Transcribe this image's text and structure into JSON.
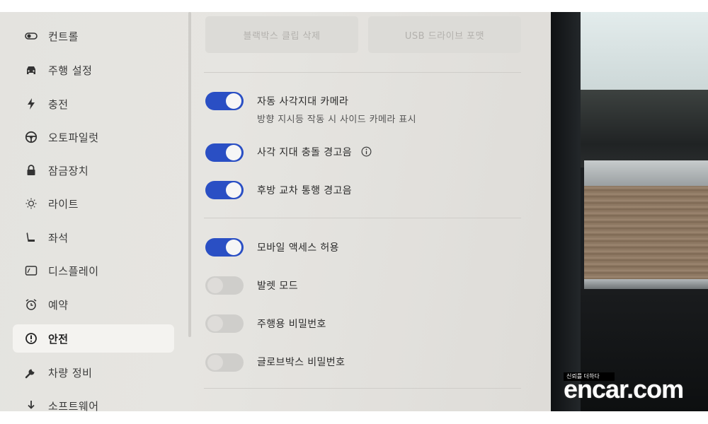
{
  "sidebar": {
    "items": [
      {
        "label": "컨트롤",
        "icon": "toggle-icon"
      },
      {
        "label": "주행 설정",
        "icon": "car-icon"
      },
      {
        "label": "충전",
        "icon": "bolt-icon"
      },
      {
        "label": "오토파일럿",
        "icon": "steering-wheel-icon"
      },
      {
        "label": "잠금장치",
        "icon": "lock-icon"
      },
      {
        "label": "라이트",
        "icon": "light-icon"
      },
      {
        "label": "좌석",
        "icon": "seat-icon"
      },
      {
        "label": "디스플레이",
        "icon": "display-icon"
      },
      {
        "label": "예약",
        "icon": "alarm-clock-icon"
      },
      {
        "label": "안전",
        "icon": "alert-circle-icon",
        "active": true
      },
      {
        "label": "차량 정비",
        "icon": "wrench-icon"
      },
      {
        "label": "소프트웨어",
        "icon": "download-icon"
      }
    ]
  },
  "main": {
    "top_buttons": [
      "블랙박스 클립 삭제",
      "USB 드라이브 포맷"
    ],
    "settings": [
      {
        "label": "자동 사각지대 카메라",
        "sub": "방향 지시등 작동 시 사이드 카메라 표시",
        "on": true
      },
      {
        "label": "사각 지대 충돌 경고음",
        "info": true,
        "on": true
      },
      {
        "label": "후방 교차 통행 경고음",
        "on": true
      },
      {
        "label": "모바일 액세스 허용",
        "on": true
      },
      {
        "label": "발렛 모드",
        "on": false
      },
      {
        "label": "주행용 비밀번호",
        "on": false
      },
      {
        "label": "글로브박스 비밀번호",
        "on": false
      }
    ]
  },
  "watermark": {
    "tagline": "신뢰를 더하다",
    "logo": "encar.com"
  },
  "colors": {
    "toggle_on": "#2a4fc4",
    "toggle_off": "#cfcecb",
    "screen_bg": "#e4e3df",
    "active_item_bg": "#f4f3f0"
  }
}
